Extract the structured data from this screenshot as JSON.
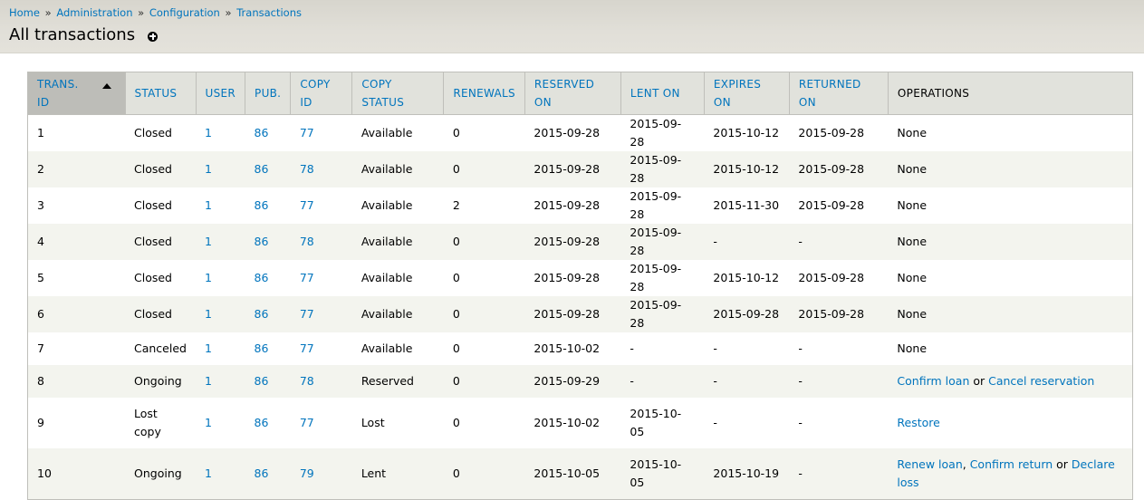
{
  "breadcrumb": [
    "Home",
    "Administration",
    "Configuration",
    "Transactions"
  ],
  "breadcrumb_sep": "»",
  "page_title": "All transactions",
  "columns": [
    "TRANS. ID",
    "STATUS",
    "USER",
    "PUB.",
    "COPY ID",
    "COPY STATUS",
    "RENEWALS",
    "RESERVED ON",
    "LENT ON",
    "EXPIRES ON",
    "RETURNED ON",
    "OPERATIONS"
  ],
  "colors": {
    "link": "#0074bd",
    "header_bg": "#e1dfd8",
    "sorted_header_bg": "#bdbdb8",
    "row_stripe": "#f3f4ee"
  },
  "rows": [
    {
      "id": "1",
      "status": "Closed",
      "user": "1",
      "pub": "86",
      "copy_id": "77",
      "copy_status": "Available",
      "renewals": "0",
      "reserved_on": "2015-09-28",
      "lent_on": "2015-09-28",
      "expires_on": "2015-10-12",
      "returned_on": "2015-09-28",
      "operations": [
        {
          "text": "None",
          "link": false
        }
      ]
    },
    {
      "id": "2",
      "status": "Closed",
      "user": "1",
      "pub": "86",
      "copy_id": "78",
      "copy_status": "Available",
      "renewals": "0",
      "reserved_on": "2015-09-28",
      "lent_on": "2015-09-28",
      "expires_on": "2015-10-12",
      "returned_on": "2015-09-28",
      "operations": [
        {
          "text": "None",
          "link": false
        }
      ]
    },
    {
      "id": "3",
      "status": "Closed",
      "user": "1",
      "pub": "86",
      "copy_id": "77",
      "copy_status": "Available",
      "renewals": "2",
      "reserved_on": "2015-09-28",
      "lent_on": "2015-09-28",
      "expires_on": "2015-11-30",
      "returned_on": "2015-09-28",
      "operations": [
        {
          "text": "None",
          "link": false
        }
      ]
    },
    {
      "id": "4",
      "status": "Closed",
      "user": "1",
      "pub": "86",
      "copy_id": "78",
      "copy_status": "Available",
      "renewals": "0",
      "reserved_on": "2015-09-28",
      "lent_on": "2015-09-28",
      "expires_on": "-",
      "returned_on": "-",
      "operations": [
        {
          "text": "None",
          "link": false
        }
      ]
    },
    {
      "id": "5",
      "status": "Closed",
      "user": "1",
      "pub": "86",
      "copy_id": "77",
      "copy_status": "Available",
      "renewals": "0",
      "reserved_on": "2015-09-28",
      "lent_on": "2015-09-28",
      "expires_on": "2015-10-12",
      "returned_on": "2015-09-28",
      "operations": [
        {
          "text": "None",
          "link": false
        }
      ]
    },
    {
      "id": "6",
      "status": "Closed",
      "user": "1",
      "pub": "86",
      "copy_id": "77",
      "copy_status": "Available",
      "renewals": "0",
      "reserved_on": "2015-09-28",
      "lent_on": "2015-09-28",
      "expires_on": "2015-09-28",
      "returned_on": "2015-09-28",
      "operations": [
        {
          "text": "None",
          "link": false
        }
      ]
    },
    {
      "id": "7",
      "status": "Canceled",
      "user": "1",
      "pub": "86",
      "copy_id": "77",
      "copy_status": "Available",
      "renewals": "0",
      "reserved_on": "2015-10-02",
      "lent_on": "-",
      "expires_on": "-",
      "returned_on": "-",
      "operations": [
        {
          "text": "None",
          "link": false
        }
      ]
    },
    {
      "id": "8",
      "status": "Ongoing",
      "user": "1",
      "pub": "86",
      "copy_id": "78",
      "copy_status": "Reserved",
      "renewals": "0",
      "reserved_on": "2015-09-29",
      "lent_on": "-",
      "expires_on": "-",
      "returned_on": "-",
      "operations": [
        {
          "text": "Confirm loan",
          "link": true
        },
        {
          "text": " or ",
          "link": false
        },
        {
          "text": "Cancel reservation",
          "link": true
        }
      ]
    },
    {
      "id": "9",
      "status": "Lost copy",
      "user": "1",
      "pub": "86",
      "copy_id": "77",
      "copy_status": "Lost",
      "renewals": "0",
      "reserved_on": "2015-10-02",
      "lent_on": "2015-10-05",
      "expires_on": "-",
      "returned_on": "-",
      "operations": [
        {
          "text": "Restore",
          "link": true
        }
      ]
    },
    {
      "id": "10",
      "status": "Ongoing",
      "user": "1",
      "pub": "86",
      "copy_id": "79",
      "copy_status": "Lent",
      "renewals": "0",
      "reserved_on": "2015-10-05",
      "lent_on": "2015-10-05",
      "expires_on": "2015-10-19",
      "returned_on": "-",
      "operations": [
        {
          "text": "Renew loan",
          "link": true
        },
        {
          "text": ", ",
          "link": false
        },
        {
          "text": "Confirm return",
          "link": true
        },
        {
          "text": " or ",
          "link": false
        },
        {
          "text": "Declare loss",
          "link": true
        }
      ]
    }
  ]
}
